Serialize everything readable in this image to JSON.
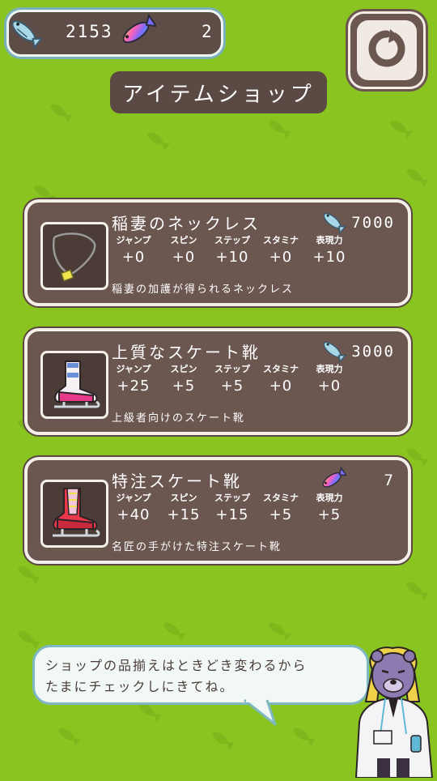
{
  "currency": {
    "fish_icon": "sardine-icon",
    "fish_count": "2153",
    "rainbow_icon": "rainbow-fish-icon",
    "rainbow_count": "2"
  },
  "refresh": {
    "icon": "refresh-icon"
  },
  "title": "アイテムショップ",
  "stat_labels": [
    "ジャンプ",
    "スピン",
    "ステップ",
    "スタミナ",
    "表現力"
  ],
  "items": [
    {
      "name": "稲妻のネックレス",
      "currency_icon": "sardine-icon",
      "price": "7000",
      "stats": [
        "+0",
        "+0",
        "+10",
        "+0",
        "+10"
      ],
      "description": "稲妻の加護が得られるネックレス",
      "icon": "necklace-icon"
    },
    {
      "name": "上質なスケート靴",
      "currency_icon": "sardine-icon",
      "price": "3000",
      "stats": [
        "+25",
        "+5",
        "+5",
        "+0",
        "+0"
      ],
      "description": "上級者向けのスケート靴",
      "icon": "skate-boot-icon"
    },
    {
      "name": "特注スケート靴",
      "currency_icon": "rainbow-fish-icon",
      "price": "7",
      "stats": [
        "+40",
        "+15",
        "+15",
        "+5",
        "+5"
      ],
      "description": "名匠の手がけた特注スケート靴",
      "icon": "custom-skate-boot-icon"
    }
  ],
  "speech": {
    "line1": "ショップの品揃えはときどき変わるから",
    "line2": "たまにチェックしにきてね。"
  },
  "colors": {
    "background": "#8ac421",
    "card": "#6b5650",
    "card_border": "#f5efea",
    "title_bg": "#5b4943",
    "bubble_border": "#7fb7c2"
  }
}
